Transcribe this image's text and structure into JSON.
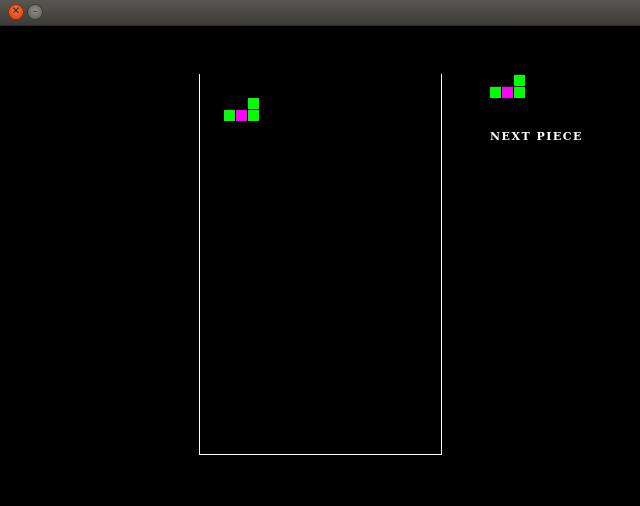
{
  "window": {
    "close_glyph": "✕",
    "minimize_glyph": "–"
  },
  "game": {
    "next_piece_label": "NEXT PIECE",
    "colors": {
      "background": "#000000",
      "board_border": "#ffffff",
      "block_green": "#00ff00",
      "block_magenta": "#ff00ff"
    },
    "current_piece": {
      "shape": "L",
      "cells": [
        "green",
        "green",
        "magenta",
        "green"
      ]
    },
    "next_piece": {
      "shape": "L",
      "cells": [
        "green",
        "green",
        "magenta",
        "green"
      ]
    }
  }
}
